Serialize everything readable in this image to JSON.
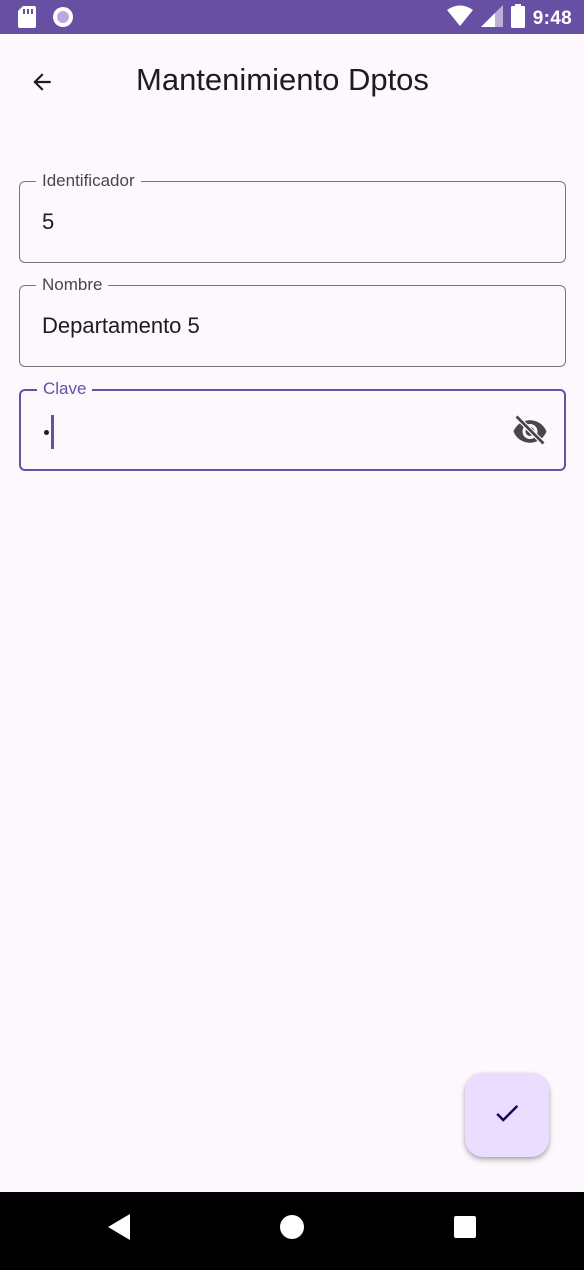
{
  "status_bar": {
    "time": "9:48",
    "icons": [
      "sd-card-icon",
      "circle-notification-icon",
      "wifi-icon",
      "signal-icon",
      "battery-icon"
    ]
  },
  "app_bar": {
    "title": "Mantenimiento Dptos",
    "back_icon": "arrow-back-icon"
  },
  "form": {
    "identificador": {
      "label": "Identificador",
      "value": "5"
    },
    "nombre": {
      "label": "Nombre",
      "value": "Departamento 5"
    },
    "clave": {
      "label": "Clave",
      "value_masked": "•",
      "toggle_icon": "visibility-off-icon"
    }
  },
  "fab": {
    "icon": "check-icon"
  },
  "nav_bar": {
    "icons": [
      "nav-back-icon",
      "nav-home-icon",
      "nav-recents-icon"
    ]
  },
  "colors": {
    "primary": "#6750a4",
    "background": "#fdf8fd",
    "fab_container": "#eaddff",
    "outline": "#79747e"
  }
}
